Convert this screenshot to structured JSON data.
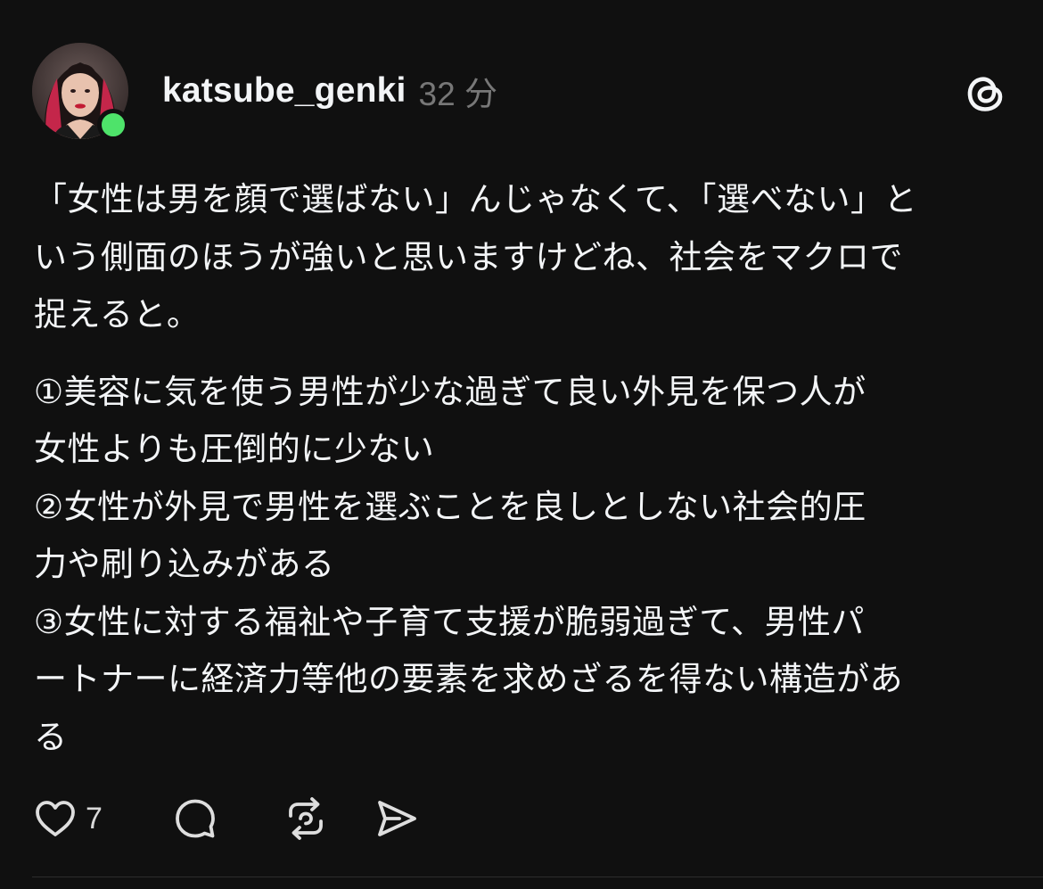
{
  "post": {
    "username": "katsube_genki",
    "timestamp": "32 分",
    "online": true,
    "body_lines": [
      "「女性は男を顔で選ばない」んじゃなくて、「選べない」と",
      "いう側面のほうが強いと思いますけどね、社会をマクロで",
      "捉えると。",
      "①美容に気を使う男性が少な過ぎて良い外見を保つ人が",
      "女性よりも圧倒的に少ない",
      "②女性が外見で男性を選ぶことを良しとしない社会的圧",
      "力や刷り込みがある",
      "③女性に対する福祉や子育て支援が脆弱過ぎて、男性パ",
      "ートナーに経済力等他の要素を求めざるを得ない構造があ",
      "る"
    ],
    "like_count": "7"
  },
  "icons": {
    "logo": "threads-logo-icon",
    "like": "heart-icon",
    "reply": "comment-bubble-icon",
    "repost": "repost-icon",
    "share": "send-icon"
  },
  "colors": {
    "background": "#101010",
    "text": "#f3f5f7",
    "muted": "#777777",
    "online": "#4ee36a"
  }
}
